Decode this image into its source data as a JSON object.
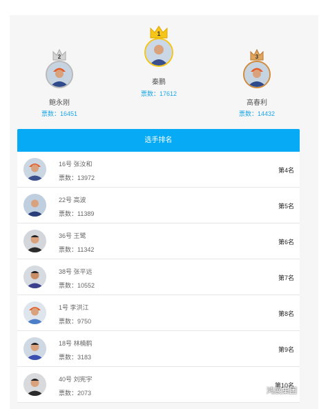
{
  "podium": {
    "first": {
      "rank": "1",
      "name": "秦鹏",
      "votes": "票数：17612"
    },
    "second": {
      "rank": "2",
      "name": "鲍永刚",
      "votes": "票数：16451"
    },
    "third": {
      "rank": "3",
      "name": "高春利",
      "votes": "票数：14432"
    }
  },
  "ranking": {
    "title": "选手排名",
    "rows": [
      {
        "name": "16号 张汝和",
        "votes": "票数：13972",
        "rank": "第4名"
      },
      {
        "name": "22号 高波",
        "votes": "票数：11389",
        "rank": "第5名"
      },
      {
        "name": "36号 王鹭",
        "votes": "票数：11342",
        "rank": "第6名"
      },
      {
        "name": "38号 张平远",
        "votes": "票数：10552",
        "rank": "第7名"
      },
      {
        "name": "1号 李洪江",
        "votes": "票数：9750",
        "rank": "第8名"
      },
      {
        "name": "18号 林楠鹤",
        "votes": "票数：3183",
        "rank": "第9名"
      },
      {
        "name": "40号 刘宪宇",
        "votes": "票数：2073",
        "rank": "第10名"
      }
    ]
  },
  "watermark": "鸿展集团",
  "colors": {
    "accent": "#07aaf5",
    "votes": "#1aa7ea",
    "gold": "#f5c518",
    "silver": "#b9b9b9",
    "bronze": "#d08a3c"
  }
}
